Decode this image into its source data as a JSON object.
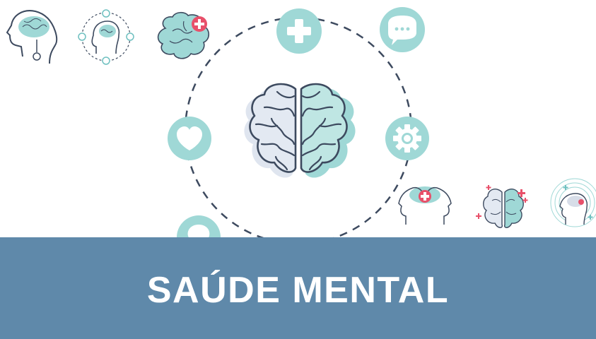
{
  "banner": {
    "title": "SAÚDE MENTAL"
  },
  "colors": {
    "banner_bg": "#5f89aa",
    "banner_text": "#ffffff",
    "teal": "#9fd8d6",
    "teal_dark": "#6fc0c0",
    "outline": "#3d4a5f",
    "brain_left_fill": "#e3e9f2",
    "pink": "#e8506a"
  },
  "icons": [
    "head-brain-icon",
    "head-connections-icon",
    "brain-medical-icon",
    "medical-cross-icon",
    "speech-bubble-icon",
    "heart-icon",
    "gear-icon",
    "lightbulb-icon",
    "central-brain-icon",
    "two-heads-icon",
    "brain-sparkles-icon",
    "head-circles-icon"
  ]
}
